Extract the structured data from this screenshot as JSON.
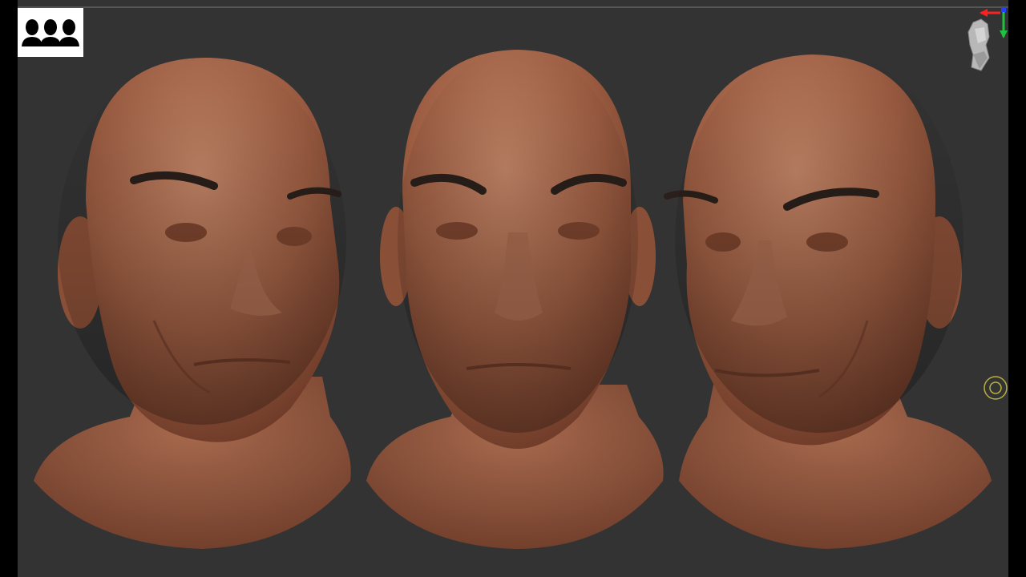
{
  "app": {
    "logo_icon": "three-heads-logo-icon",
    "gizmo_icon": "navigation-head-gizmo-icon",
    "focus_icon": "focal-circle-icon"
  },
  "viewport": {
    "background": "#333333",
    "sculpt_color": "#9a5a3f",
    "models": [
      {
        "name": "head-three-quarter-left"
      },
      {
        "name": "head-front"
      },
      {
        "name": "head-three-quarter-right"
      }
    ]
  }
}
